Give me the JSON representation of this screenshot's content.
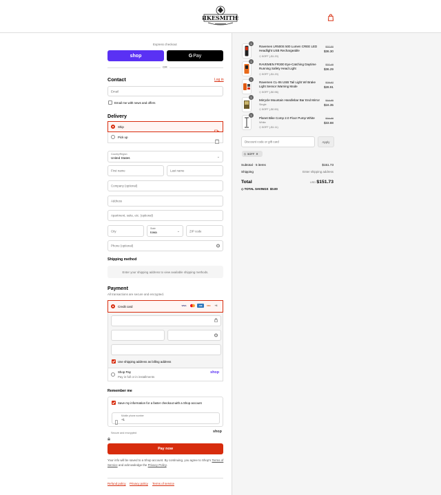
{
  "brand": {
    "name": "BIKESMITHS"
  },
  "checkout": {
    "express_label": "Express checkout",
    "shop_pay_label": "shop",
    "gpay_label": "Pay",
    "or_label": "OR",
    "contact_title": "Contact",
    "login_link": "Log in",
    "email_placeholder": "Email",
    "email_news_label": "Email me with news and offers",
    "delivery_title": "Delivery",
    "ship_label": "Ship",
    "pickup_label": "Pick up",
    "country_label": "Country/Region",
    "country_value": "United States",
    "first_name_placeholder": "First name",
    "last_name_placeholder": "Last name",
    "company_placeholder": "Company (optional)",
    "address_placeholder": "Address",
    "apartment_placeholder": "Apartment, suite, etc. (optional)",
    "city_placeholder": "City",
    "state_label": "State",
    "state_value": "Iowa",
    "zip_placeholder": "ZIP code",
    "phone_placeholder": "Phone (optional)",
    "shipping_method_title": "Shipping method",
    "shipping_method_msg": "Enter your shipping address to view available shipping methods.",
    "payment_title": "Payment",
    "payment_subtitle": "All transactions are secure and encrypted.",
    "credit_card_label": "Credit card",
    "card_more": "+4",
    "billing_same_label": "Use shipping address as billing address",
    "shop_pay_title": "Shop Pay",
    "shop_pay_sub": "Pay in full or in installments",
    "shop_pay_logo": "shop",
    "remember_title": "Remember me",
    "remember_label": "Save my information for a faster checkout with a Shop account",
    "mobile_label": "Mobile phone number",
    "mobile_value": "+1",
    "secure_label": "Secure and encrypted",
    "secure_logo": "shop",
    "pay_now_label": "Pay now",
    "shop_notice_1": "Your info will be saved to a Shop account. By continuing, you agree to Shop's",
    "shop_notice_terms": "Terms of Service",
    "shop_notice_mid": "and acknowledge the",
    "shop_notice_privacy": "Privacy Policy",
    "shop_notice_end": ".",
    "footer_refund": "Refund policy",
    "footer_privacy": "Privacy policy",
    "footer_terms": "Terms of service"
  },
  "order": {
    "items": [
      {
        "qty": "1",
        "name": "Ravemen LR500S 500 Lumen CREE LED Headlight USB Rechargeable",
        "variant": "",
        "discount": "5OFF (-$1.20)",
        "old_price": "$37.50",
        "price": "$36.30",
        "color": "#d72c0d"
      },
      {
        "qty": "1",
        "name": "RAVEMEN FR300 Eye-Catching Daytime Running Safety Head Light",
        "variant": "",
        "discount": "5OFF (-$1.20)",
        "old_price": "$37.49",
        "price": "$36.29",
        "color": "#e86a1a"
      },
      {
        "qty": "1",
        "name": "Ravemen CL-06 USB Tail Light W/ Brake Light Sensor Warning Mode",
        "variant": "",
        "discount": "5OFF (-$0.96)",
        "old_price": "$29.87",
        "price": "$28.91",
        "color": "#e05a12"
      },
      {
        "qty": "1",
        "name": "Mirrycle Mountain Handlebar Bar End Mirror",
        "variant": "Single",
        "discount": "5OFF (-$0.50)",
        "old_price": "$16.85",
        "price": "$16.35",
        "color": "#6b5a2a"
      },
      {
        "qty": "1",
        "name": "Planet Bike Comp 2.0 Floor Pump White",
        "variant": "White",
        "discount": "5OFF (-$1.11)",
        "old_price": "$34.99",
        "price": "$33.88",
        "color": "#333333"
      }
    ],
    "discount_placeholder": "Discount code or gift card",
    "apply_label": "Apply",
    "applied_code": "5OFF",
    "subtotal_label": "Subtotal · 5 items",
    "subtotal_value": "$151.73",
    "shipping_label": "Shipping",
    "shipping_value": "Enter shipping address",
    "total_label": "Total",
    "currency": "USD",
    "total_value": "$151.73",
    "savings_label": "TOTAL SAVINGS",
    "savings_value": "$0.00"
  },
  "colors": {
    "accent": "#d72c0d",
    "shop_purple": "#5a31f4"
  }
}
